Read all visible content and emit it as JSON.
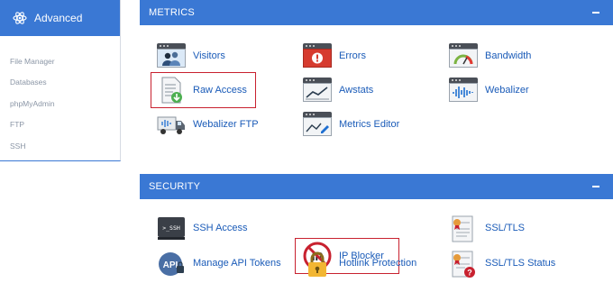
{
  "sidebar": {
    "title": "Advanced",
    "items": [
      {
        "label": "File Manager"
      },
      {
        "label": "Databases"
      },
      {
        "label": "phpMyAdmin"
      },
      {
        "label": "FTP"
      },
      {
        "label": "SSH"
      }
    ]
  },
  "metrics": {
    "title": "METRICS",
    "tools": [
      {
        "label": "Visitors"
      },
      {
        "label": "Errors"
      },
      {
        "label": "Bandwidth"
      },
      {
        "label": "Raw Access"
      },
      {
        "label": "Awstats"
      },
      {
        "label": "Webalizer"
      },
      {
        "label": "Webalizer FTP"
      },
      {
        "label": "Metrics Editor"
      }
    ]
  },
  "security": {
    "title": "SECURITY",
    "tools": [
      {
        "label": "SSH Access",
        "icon_text": ">_SSH"
      },
      {
        "label": "IP Blocker",
        "icon_text": "IP"
      },
      {
        "label": "SSL/TLS"
      },
      {
        "label": "Manage API Tokens",
        "icon_text": "API"
      },
      {
        "label": "Hotlink Protection"
      },
      {
        "label": "SSL/TLS Status"
      }
    ]
  },
  "colors": {
    "accent": "#3a78d4",
    "link": "#1a5bb8",
    "highlight_border": "#c8212f"
  }
}
